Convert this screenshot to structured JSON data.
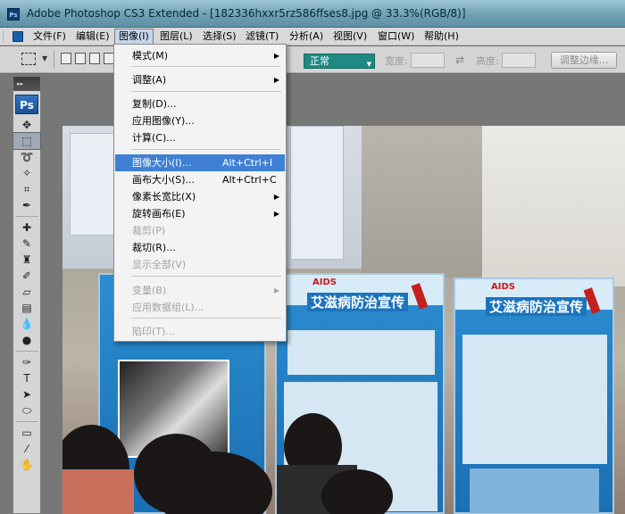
{
  "window": {
    "app_badge": "Ps",
    "title": "Adobe Photoshop CS3 Extended - [182336hxxr5rz586ffses8.jpg @ 33.3%(RGB/8)]"
  },
  "menubar": [
    {
      "label": "文件(F)"
    },
    {
      "label": "编辑(E)"
    },
    {
      "label": "图像(I)"
    },
    {
      "label": "图层(L)"
    },
    {
      "label": "选择(S)"
    },
    {
      "label": "滤镜(T)"
    },
    {
      "label": "分析(A)"
    },
    {
      "label": "视图(V)"
    },
    {
      "label": "窗口(W)"
    },
    {
      "label": "帮助(H)"
    }
  ],
  "options_bar": {
    "style_value": "正常",
    "width_label": "宽度:",
    "height_label": "高度:",
    "refine_edge_label": "调整边缘..."
  },
  "image_menu": {
    "mode": {
      "label": "模式(M)",
      "submenu": true
    },
    "adjust": {
      "label": "调整(A)",
      "submenu": true
    },
    "duplicate": {
      "label": "复制(D)..."
    },
    "apply_image": {
      "label": "应用图像(Y)..."
    },
    "calculations": {
      "label": "计算(C)..."
    },
    "image_size": {
      "label": "图像大小(I)...",
      "shortcut": "Alt+Ctrl+I",
      "highlighted": true
    },
    "canvas_size": {
      "label": "画布大小(S)...",
      "shortcut": "Alt+Ctrl+C"
    },
    "pixel_aspect": {
      "label": "像素长宽比(X)",
      "submenu": true
    },
    "rotate_canvas": {
      "label": "旋转画布(E)",
      "submenu": true
    },
    "crop": {
      "label": "裁剪(P)",
      "disabled": true
    },
    "trim": {
      "label": "裁切(R)..."
    },
    "reveal_all": {
      "label": "显示全部(V)",
      "disabled": true
    },
    "variables": {
      "label": "变量(B)",
      "disabled": true,
      "submenu": true
    },
    "apply_data_set": {
      "label": "应用数据组(L)...",
      "disabled": true
    },
    "trap": {
      "label": "陷印(T)...",
      "disabled": true
    }
  },
  "toolbox": {
    "logo": "Ps"
  },
  "photo": {
    "board_heading": "艾滋病防治宣传",
    "board_logo": "AIDS"
  }
}
